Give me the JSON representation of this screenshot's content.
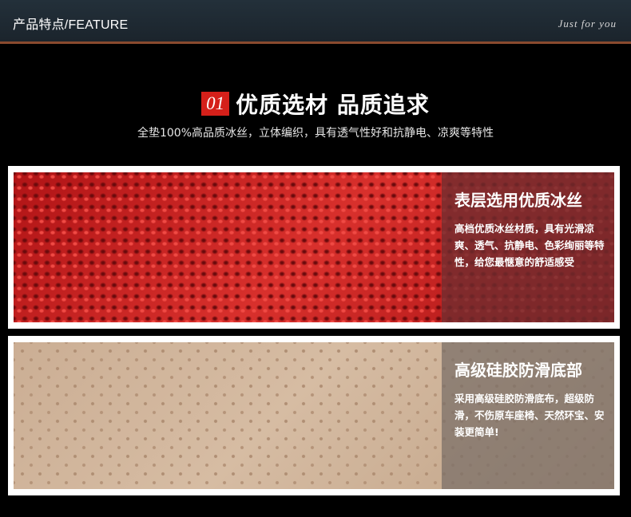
{
  "header": {
    "title": "产品特点/FEATURE",
    "tagline": "Just for you"
  },
  "section": {
    "number": "01",
    "heading": "优质选材 品质追求",
    "subheading": "全垫100%高品质冰丝，立体编织，具有透气性好和抗静电、凉爽等特性"
  },
  "panels": [
    {
      "title": "表层选用优质冰丝",
      "body": "高档优质冰丝材质，具有光滑凉爽、透气、抗静电、色彩绚丽等特性，给您最惬意的舒适感受"
    },
    {
      "title": "高级硅胶防滑底部",
      "body": "采用高级硅胶防滑底布，超级防滑，不伤原车座椅、天然环宝、安装更简单!"
    }
  ],
  "colors": {
    "accent_red": "#d5201a",
    "header_bg": "#1f2a33",
    "header_rule": "#8a4a2e"
  }
}
